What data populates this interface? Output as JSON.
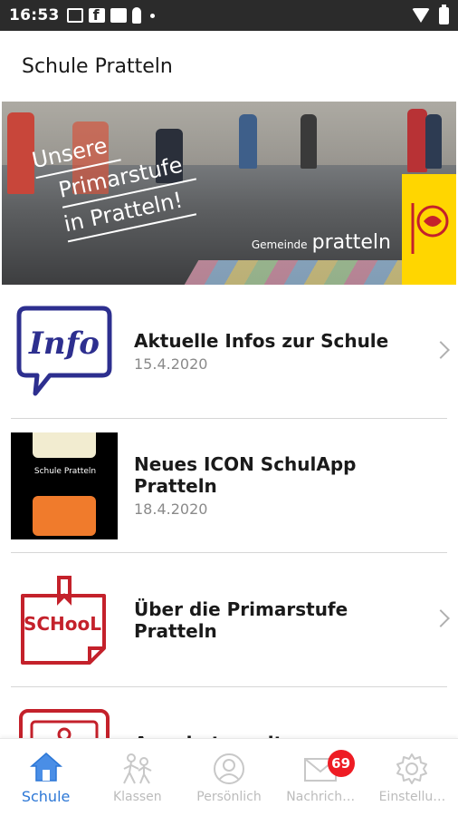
{
  "status_bar": {
    "time": "16:53",
    "icons": [
      "mail-icon",
      "facebook-icon",
      "image-icon",
      "key-icon",
      "dot-icon",
      "wifi-icon",
      "battery-icon"
    ]
  },
  "header": {
    "title": "Schule Pratteln"
  },
  "banner": {
    "line1": "Unsere",
    "line2": "Primarstufe",
    "line3": "in Pratteln!",
    "brand_small": "Gemeinde",
    "brand_big": "pratteln",
    "crest_color": "#ffd600"
  },
  "list": {
    "items": [
      {
        "title": "Aktuelle Infos zur Schule",
        "date": "15.4.2020",
        "thumb": "info-speech-bubble-icon",
        "has_chevron": true
      },
      {
        "title": "Neues ICON SchulApp Pratteln",
        "date": "18.4.2020",
        "thumb": "app-screenshot",
        "thumb_text": "Schule Pratteln",
        "has_chevron": false
      },
      {
        "title": "Über die Primarstufe Pratteln",
        "date": "",
        "thumb": "school-note-icon",
        "has_chevron": true
      },
      {
        "title": "Angebote weiterer",
        "date": "",
        "thumb": "board-icon",
        "has_chevron": false
      }
    ]
  },
  "bottom_nav": {
    "items": [
      {
        "label": "Schule",
        "icon": "home-icon",
        "active": true
      },
      {
        "label": "Klassen",
        "icon": "students-icon",
        "active": false
      },
      {
        "label": "Persönlich",
        "icon": "person-icon",
        "active": false
      },
      {
        "label": "Nachrich…",
        "icon": "envelope-icon",
        "active": false,
        "badge": "69"
      },
      {
        "label": "Einstellu…",
        "icon": "gear-icon",
        "active": false
      }
    ]
  },
  "colors": {
    "accent": "#2c77d6",
    "badge": "#ee1c24",
    "info_blue": "#2d2f8f",
    "school_red": "#c4212b"
  }
}
